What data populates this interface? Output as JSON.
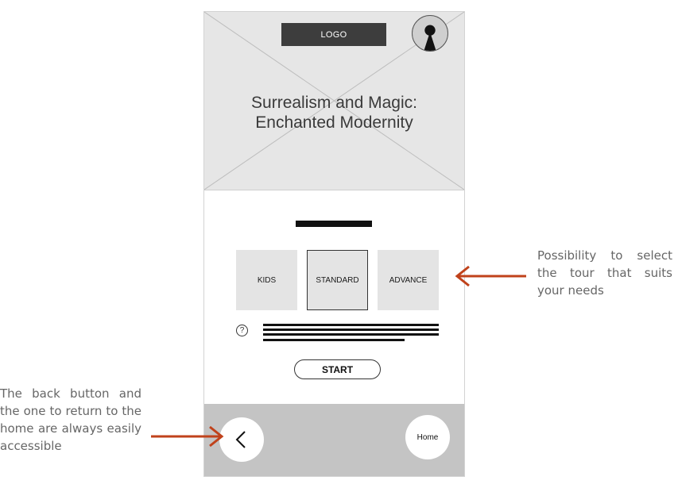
{
  "header": {
    "logo_label": "LOGO",
    "title_line1": "Surrealism and Magic:",
    "title_line2": "Enchanted Modernity"
  },
  "tour_options": [
    {
      "label": "KIDS",
      "selected": false
    },
    {
      "label": "STANDARD",
      "selected": true
    },
    {
      "label": "ADVANCE",
      "selected": false
    }
  ],
  "help_icon_glyph": "?",
  "start_label": "START",
  "nav": {
    "back_glyph": "<",
    "home_label": "Home"
  },
  "annotations": {
    "tour_select_note": "Possibility to select the tour that suits your needs",
    "navigation_note": "The back button and the one to return to the home are always easily accessible"
  },
  "colors": {
    "arrow": "#c0421b",
    "hero_bg": "#e6e6e6",
    "bottom_bar_bg": "#c4c4c4",
    "option_bg": "#e4e4e4"
  }
}
